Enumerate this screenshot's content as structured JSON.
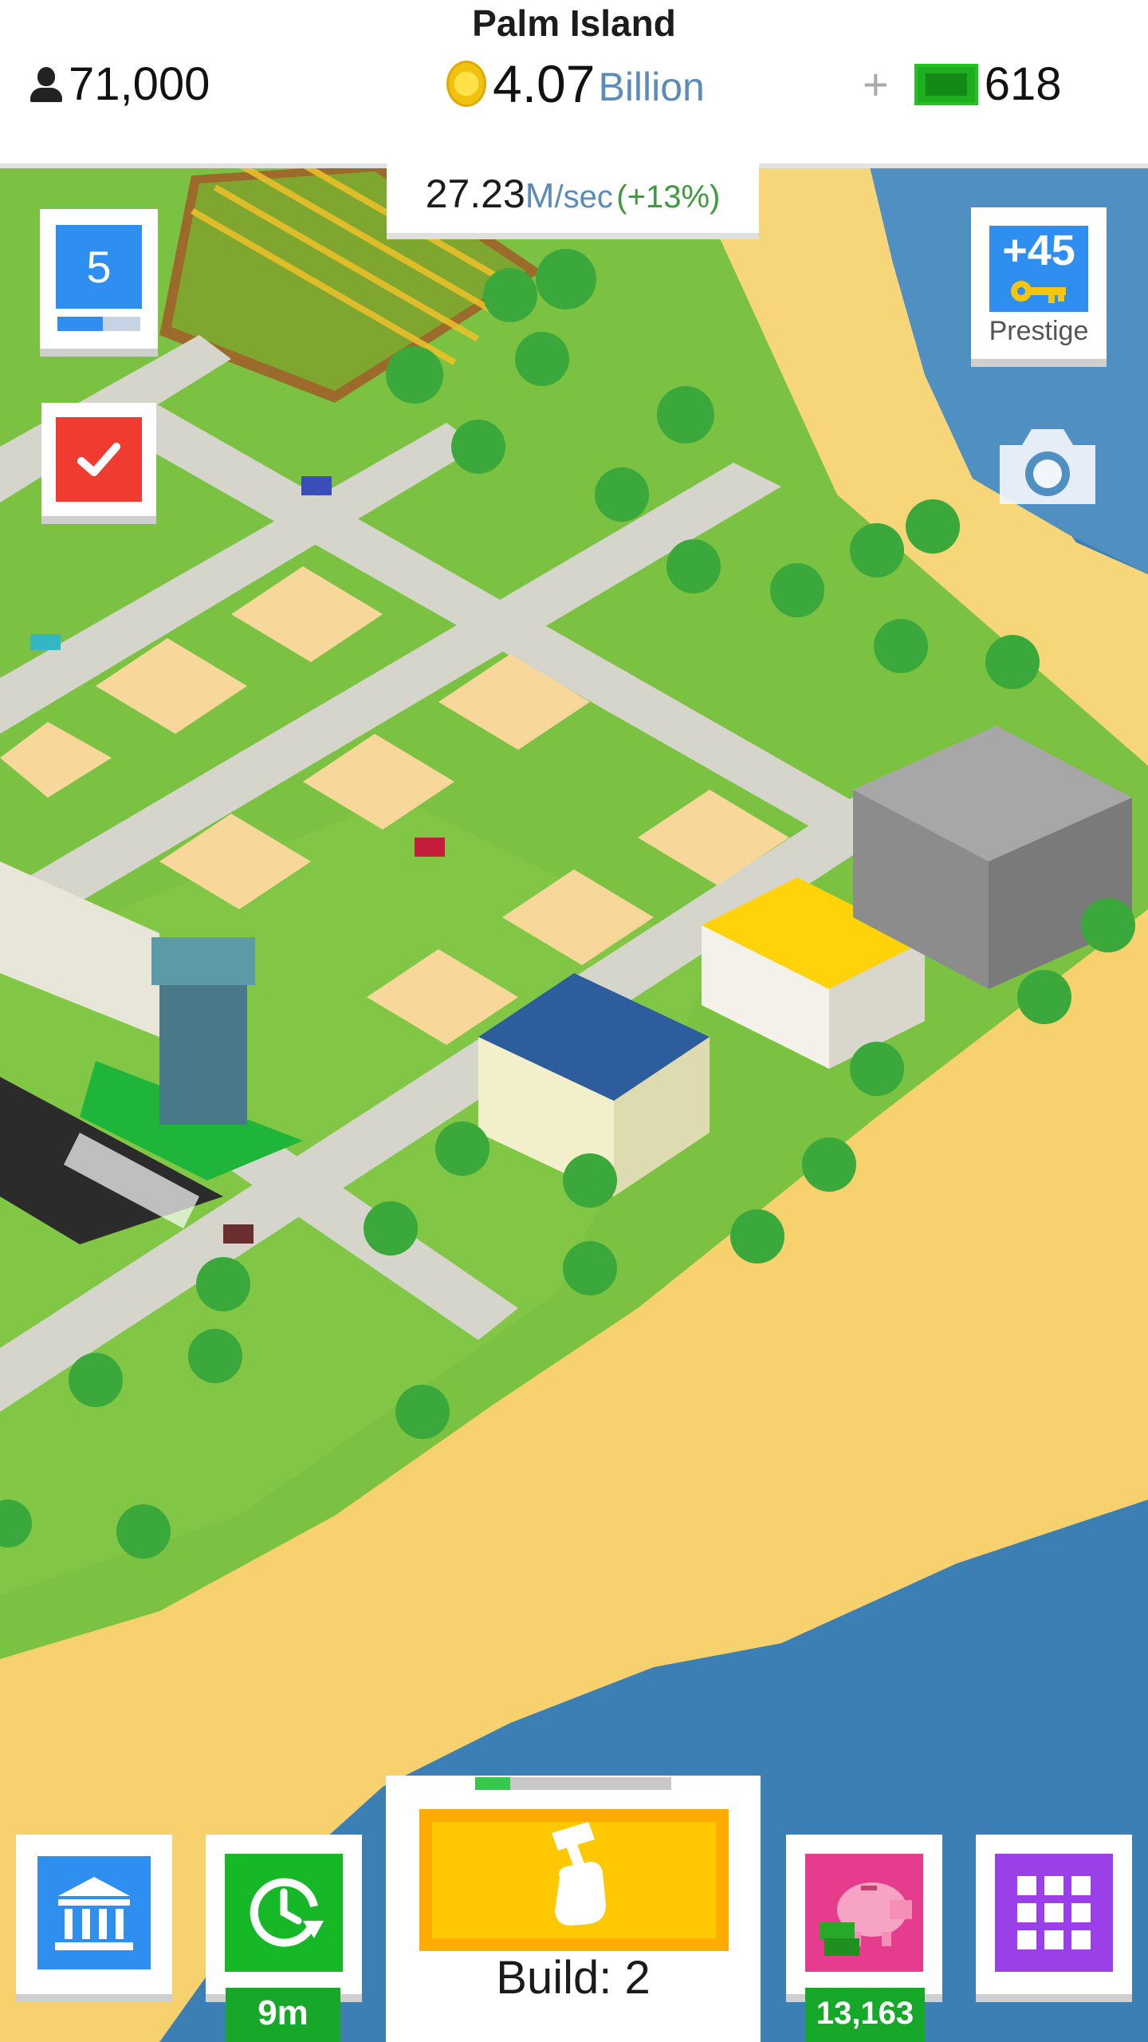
{
  "header": {
    "island_name": "Palm Island",
    "population": "71,000",
    "coins_value": "4.07",
    "coins_unit": "Billion",
    "cash_value": "618",
    "icons": [
      "person-icon",
      "coin-icon",
      "plus-icon",
      "cash-icon"
    ]
  },
  "income": {
    "value": "27.23",
    "unit": "M",
    "per": "/sec",
    "bonus": "(+13%)"
  },
  "level": {
    "value": "5",
    "progress": 0.55
  },
  "tasks": {
    "icon": "checkmark-icon"
  },
  "prestige": {
    "keys": "+45",
    "label": "Prestige",
    "icon": "key-icon"
  },
  "camera": {
    "icon": "camera-icon"
  },
  "bottom_bar": {
    "bank": {
      "icon": "bank-icon"
    },
    "boost": {
      "icon": "clock-refresh-icon",
      "timer": "9m"
    },
    "build": {
      "label": "Build: 2",
      "progress": 0.18,
      "icon": "hammer-hand-icon"
    },
    "piggy_bank": {
      "icon": "piggy-bank-icon",
      "amount": "13,163"
    },
    "menu": {
      "icon": "grid-icon"
    }
  },
  "colors": {
    "grass": "#7cc242",
    "sand": "#f7d67a",
    "sea": "#3c7fb5",
    "road": "#d5d5cc",
    "accent_blue": "#2f8ff0",
    "accent_green": "#17b828",
    "accent_red": "#ef3b30",
    "accent_yellow": "#ffc800",
    "accent_pink": "#e63c8e",
    "accent_purple": "#9b3fe8"
  }
}
